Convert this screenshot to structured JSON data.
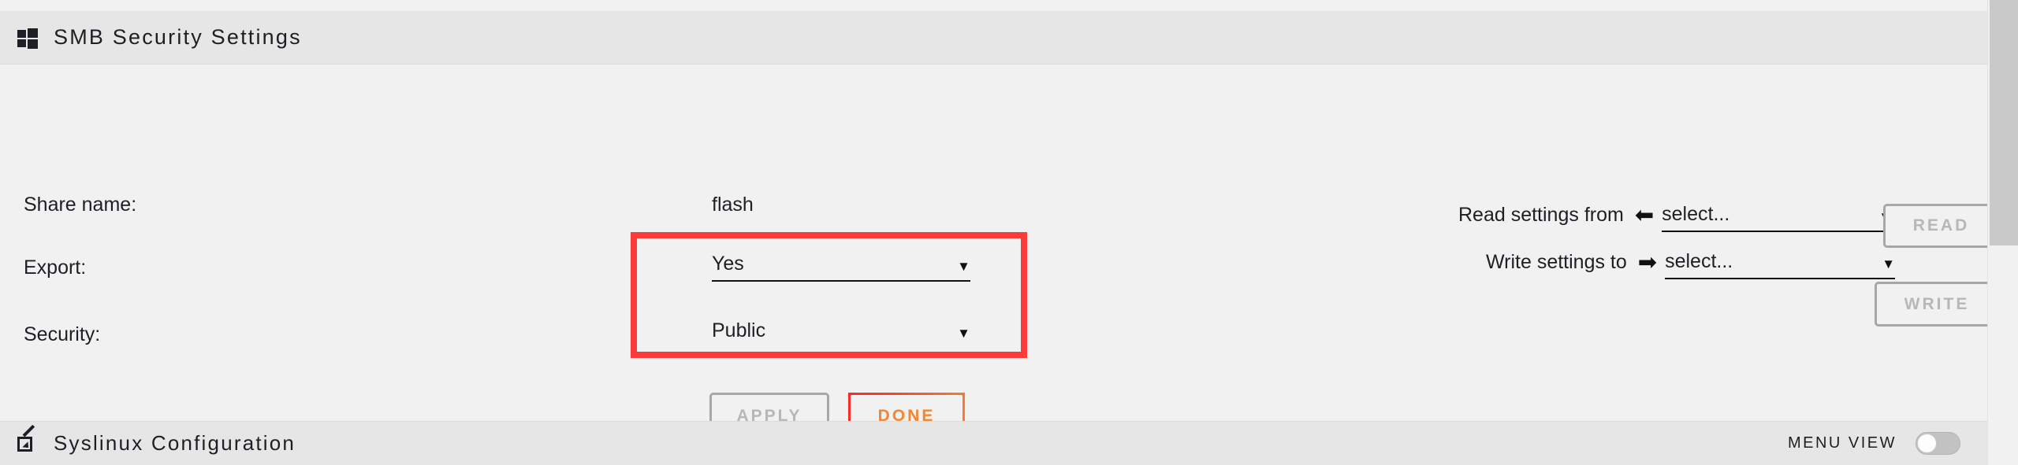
{
  "header": {
    "icon": "windows-logo-icon",
    "title": "SMB Security Settings"
  },
  "form": {
    "share_name_label": "Share name:",
    "share_name_value": "flash",
    "export_label": "Export:",
    "export_value": "Yes",
    "security_label": "Security:",
    "security_value": "Public",
    "caret": "▼"
  },
  "highlight": {
    "color": "#fb3b38"
  },
  "transfer": {
    "read_label": "Read settings from",
    "read_arrow": "⬅",
    "read_select_value": "select...",
    "read_button": "READ",
    "write_label": "Write settings to",
    "write_arrow": "➡",
    "write_select_value": "select...",
    "write_button": "WRITE",
    "caret": "▼"
  },
  "actions": {
    "apply_label": "APPLY",
    "done_label": "DONE",
    "done_color": "#f7852f"
  },
  "bottom": {
    "icon": "edit-pencil-square-icon",
    "title": "Syslinux Configuration",
    "menu_view_label": "MENU VIEW",
    "menu_view_state": "off"
  }
}
